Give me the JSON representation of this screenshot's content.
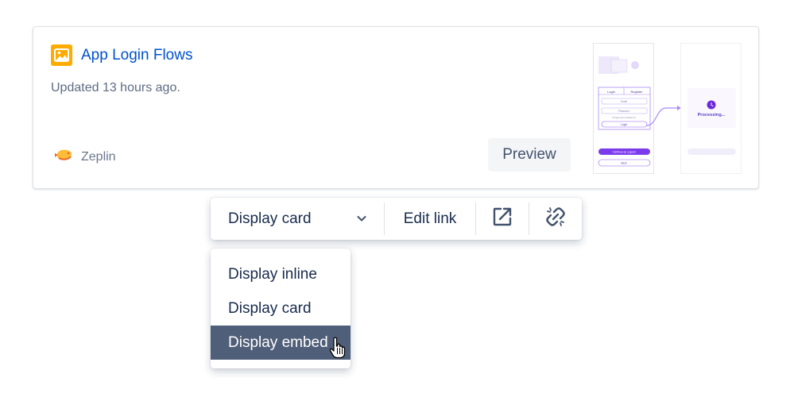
{
  "card": {
    "title": "App Login Flows",
    "updated": "Updated 13 hours ago.",
    "provider_name": "Zeplin",
    "preview_label": "Preview",
    "icon": "image-icon",
    "provider_icon": "zeplin-logo-icon",
    "icon_color": "#FFAB00",
    "title_color": "#0052CC",
    "thumbnail": {
      "tab_login": "Login",
      "tab_register": "Register",
      "field_email": "Email",
      "field_password": "Password",
      "forgot": "Forgot your password",
      "login_button": "Login",
      "guest_button": "Continue as a guest",
      "back_button": "Back",
      "processing": "Processing..."
    }
  },
  "toolbar": {
    "display_select_label": "Display card",
    "edit_link_label": "Edit link",
    "open_icon": "external-link-icon",
    "unlink_icon": "unlink-icon"
  },
  "dropdown": {
    "options": [
      {
        "label": "Display inline",
        "selected": false
      },
      {
        "label": "Display card",
        "selected": false
      },
      {
        "label": "Display embed",
        "selected": true
      }
    ],
    "selected_color": "#505F79"
  },
  "cursor": "hand-pointer-cursor"
}
